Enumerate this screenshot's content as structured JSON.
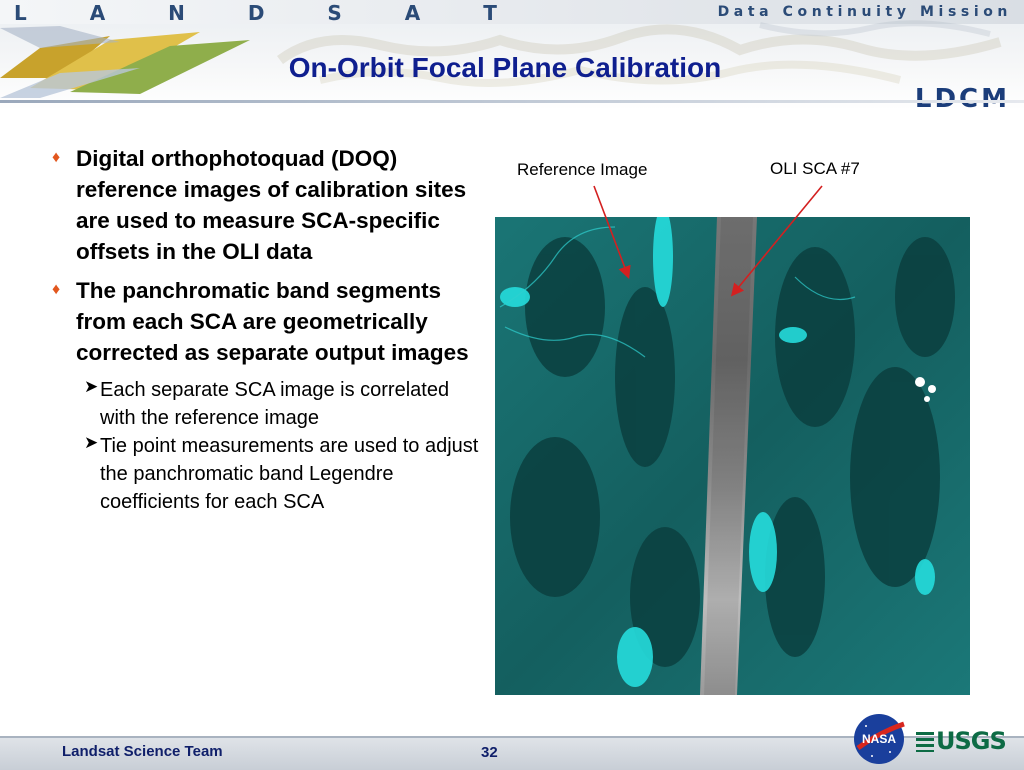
{
  "header": {
    "program": "L A N D S A T",
    "mission": "Data Continuity Mission",
    "title": "On-Orbit Focal Plane Calibration",
    "mission_abbrev": "LDCM"
  },
  "bullets": [
    {
      "text": "Digital orthophotoquad (DOQ) reference images of calibration sites are used to measure SCA-specific offsets in the OLI data",
      "subs": []
    },
    {
      "text": "The panchromatic band segments from each SCA are geometrically corrected as separate output images",
      "subs": [
        "Each separate SCA image is correlated with the reference image",
        "Tie point measurements are used to adjust the panchromatic band Legendre coefficients for each SCA"
      ]
    }
  ],
  "figure": {
    "label_reference": "Reference Image",
    "label_sca": "OLI SCA #7"
  },
  "footer": {
    "team": "Landsat Science Team",
    "page": "32",
    "logo_nasa": "NASA",
    "logo_usgs": "USGS"
  },
  "colors": {
    "title": "#0f1f8f",
    "bullet_marker": "#e2571e",
    "leader_arrows": "#d32020",
    "image_cyan": "#19c8c8"
  }
}
